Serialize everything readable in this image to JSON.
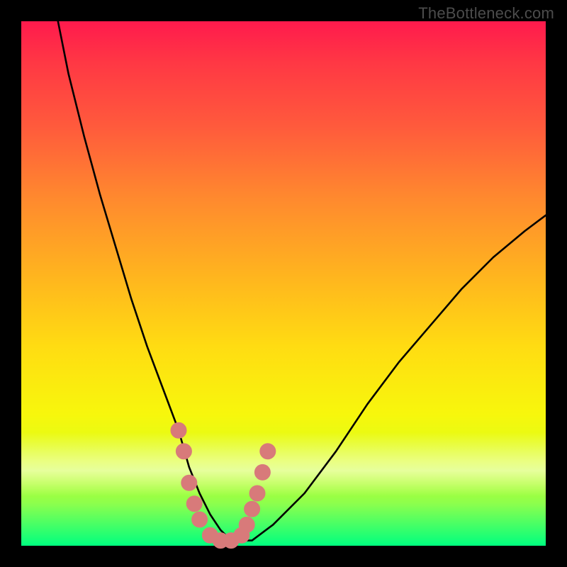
{
  "watermark": "TheBottleneck.com",
  "colors": {
    "frame": "#000000",
    "curve": "#000000",
    "markers": "#d87a7a",
    "gradient_stops": [
      "#ff1a4d",
      "#ff5a3c",
      "#ffb31f",
      "#f7f70c",
      "#8cff4d",
      "#00ff7f"
    ]
  },
  "chart_data": {
    "type": "line",
    "title": "",
    "xlabel": "",
    "ylabel": "",
    "xlim": [
      0,
      100
    ],
    "ylim": [
      0,
      100
    ],
    "grid": false,
    "legend": false,
    "series": [
      {
        "name": "bottleneck-curve",
        "x": [
          7,
          9,
          12,
          15,
          18,
          21,
          24,
          27,
          30,
          32,
          34,
          36,
          38,
          40,
          44,
          48,
          54,
          60,
          66,
          72,
          78,
          84,
          90,
          96,
          100
        ],
        "y": [
          100,
          90,
          78,
          67,
          57,
          47,
          38,
          30,
          22,
          15,
          10,
          6,
          3,
          1,
          1,
          4,
          10,
          18,
          27,
          35,
          42,
          49,
          55,
          60,
          63
        ]
      }
    ],
    "markers": [
      {
        "x": 30,
        "y": 22
      },
      {
        "x": 31,
        "y": 18
      },
      {
        "x": 32,
        "y": 12
      },
      {
        "x": 33,
        "y": 8
      },
      {
        "x": 34,
        "y": 5
      },
      {
        "x": 36,
        "y": 2
      },
      {
        "x": 38,
        "y": 1
      },
      {
        "x": 40,
        "y": 1
      },
      {
        "x": 42,
        "y": 2
      },
      {
        "x": 43,
        "y": 4
      },
      {
        "x": 44,
        "y": 7
      },
      {
        "x": 45,
        "y": 10
      },
      {
        "x": 46,
        "y": 14
      },
      {
        "x": 47,
        "y": 18
      }
    ],
    "bottleneck_minimum_x": 39
  }
}
